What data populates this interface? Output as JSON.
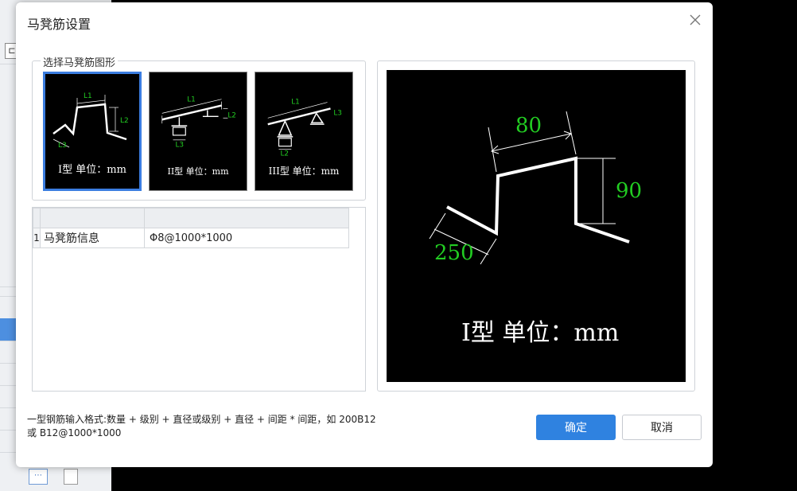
{
  "dialog": {
    "title": "马凳筋设置",
    "close_icon": "close-icon"
  },
  "shape_group": {
    "title": "选择马凳筋图形",
    "selected_index": 0,
    "options": [
      {
        "caption": "I型 单位：mm",
        "labels": [
          "L1",
          "L2",
          "L3"
        ]
      },
      {
        "caption": "II型 单位：mm",
        "labels": [
          "L1",
          "L2",
          "L3"
        ]
      },
      {
        "caption": "III型 单位：mm",
        "labels": [
          "L1",
          "L3",
          "L2"
        ]
      }
    ]
  },
  "table": {
    "header": [
      "",
      ""
    ],
    "rows": [
      {
        "num": "1",
        "name": "马凳筋信息",
        "value": "Φ8@1000*1000"
      }
    ]
  },
  "preview": {
    "dimensions": {
      "top": "80",
      "right": "90",
      "left": "250"
    },
    "caption": "I型 单位：mm"
  },
  "help_text": "一型钢筋输入格式:数量 + 级别 + 直径或级别 + 直径 + 间距 * 间距，如 200B12\n或 B12@1000*1000",
  "buttons": {
    "ok": "确定",
    "cancel": "取消"
  },
  "colors": {
    "accent": "#2f82e0",
    "dimension_text": "#22cc22",
    "canvas_bg": "#000000"
  },
  "background": {
    "dots_icon": "ellipsis-icon"
  }
}
